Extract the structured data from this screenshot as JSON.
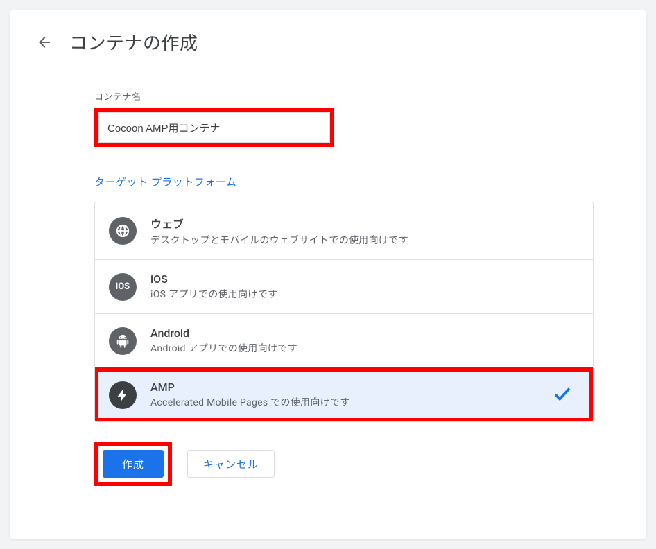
{
  "header": {
    "title": "コンテナの作成"
  },
  "form": {
    "name_label": "コンテナ名",
    "name_value": "Cocoon AMP用コンテナ",
    "platform_label": "ターゲット プラットフォーム"
  },
  "platforms": [
    {
      "id": "web",
      "title": "ウェブ",
      "desc": "デスクトップとモバイルのウェブサイトでの使用向けです",
      "selected": false,
      "icon": "globe"
    },
    {
      "id": "ios",
      "title": "iOS",
      "desc": "iOS アプリでの使用向けです",
      "selected": false,
      "icon": "ios"
    },
    {
      "id": "android",
      "title": "Android",
      "desc": "Android アプリでの使用向けです",
      "selected": false,
      "icon": "android"
    },
    {
      "id": "amp",
      "title": "AMP",
      "desc": "Accelerated Mobile Pages での使用向けです",
      "selected": true,
      "icon": "bolt"
    }
  ],
  "buttons": {
    "create": "作成",
    "cancel": "キャンセル"
  },
  "highlights": {
    "name_input": true,
    "amp_row": true,
    "create_button": true
  }
}
